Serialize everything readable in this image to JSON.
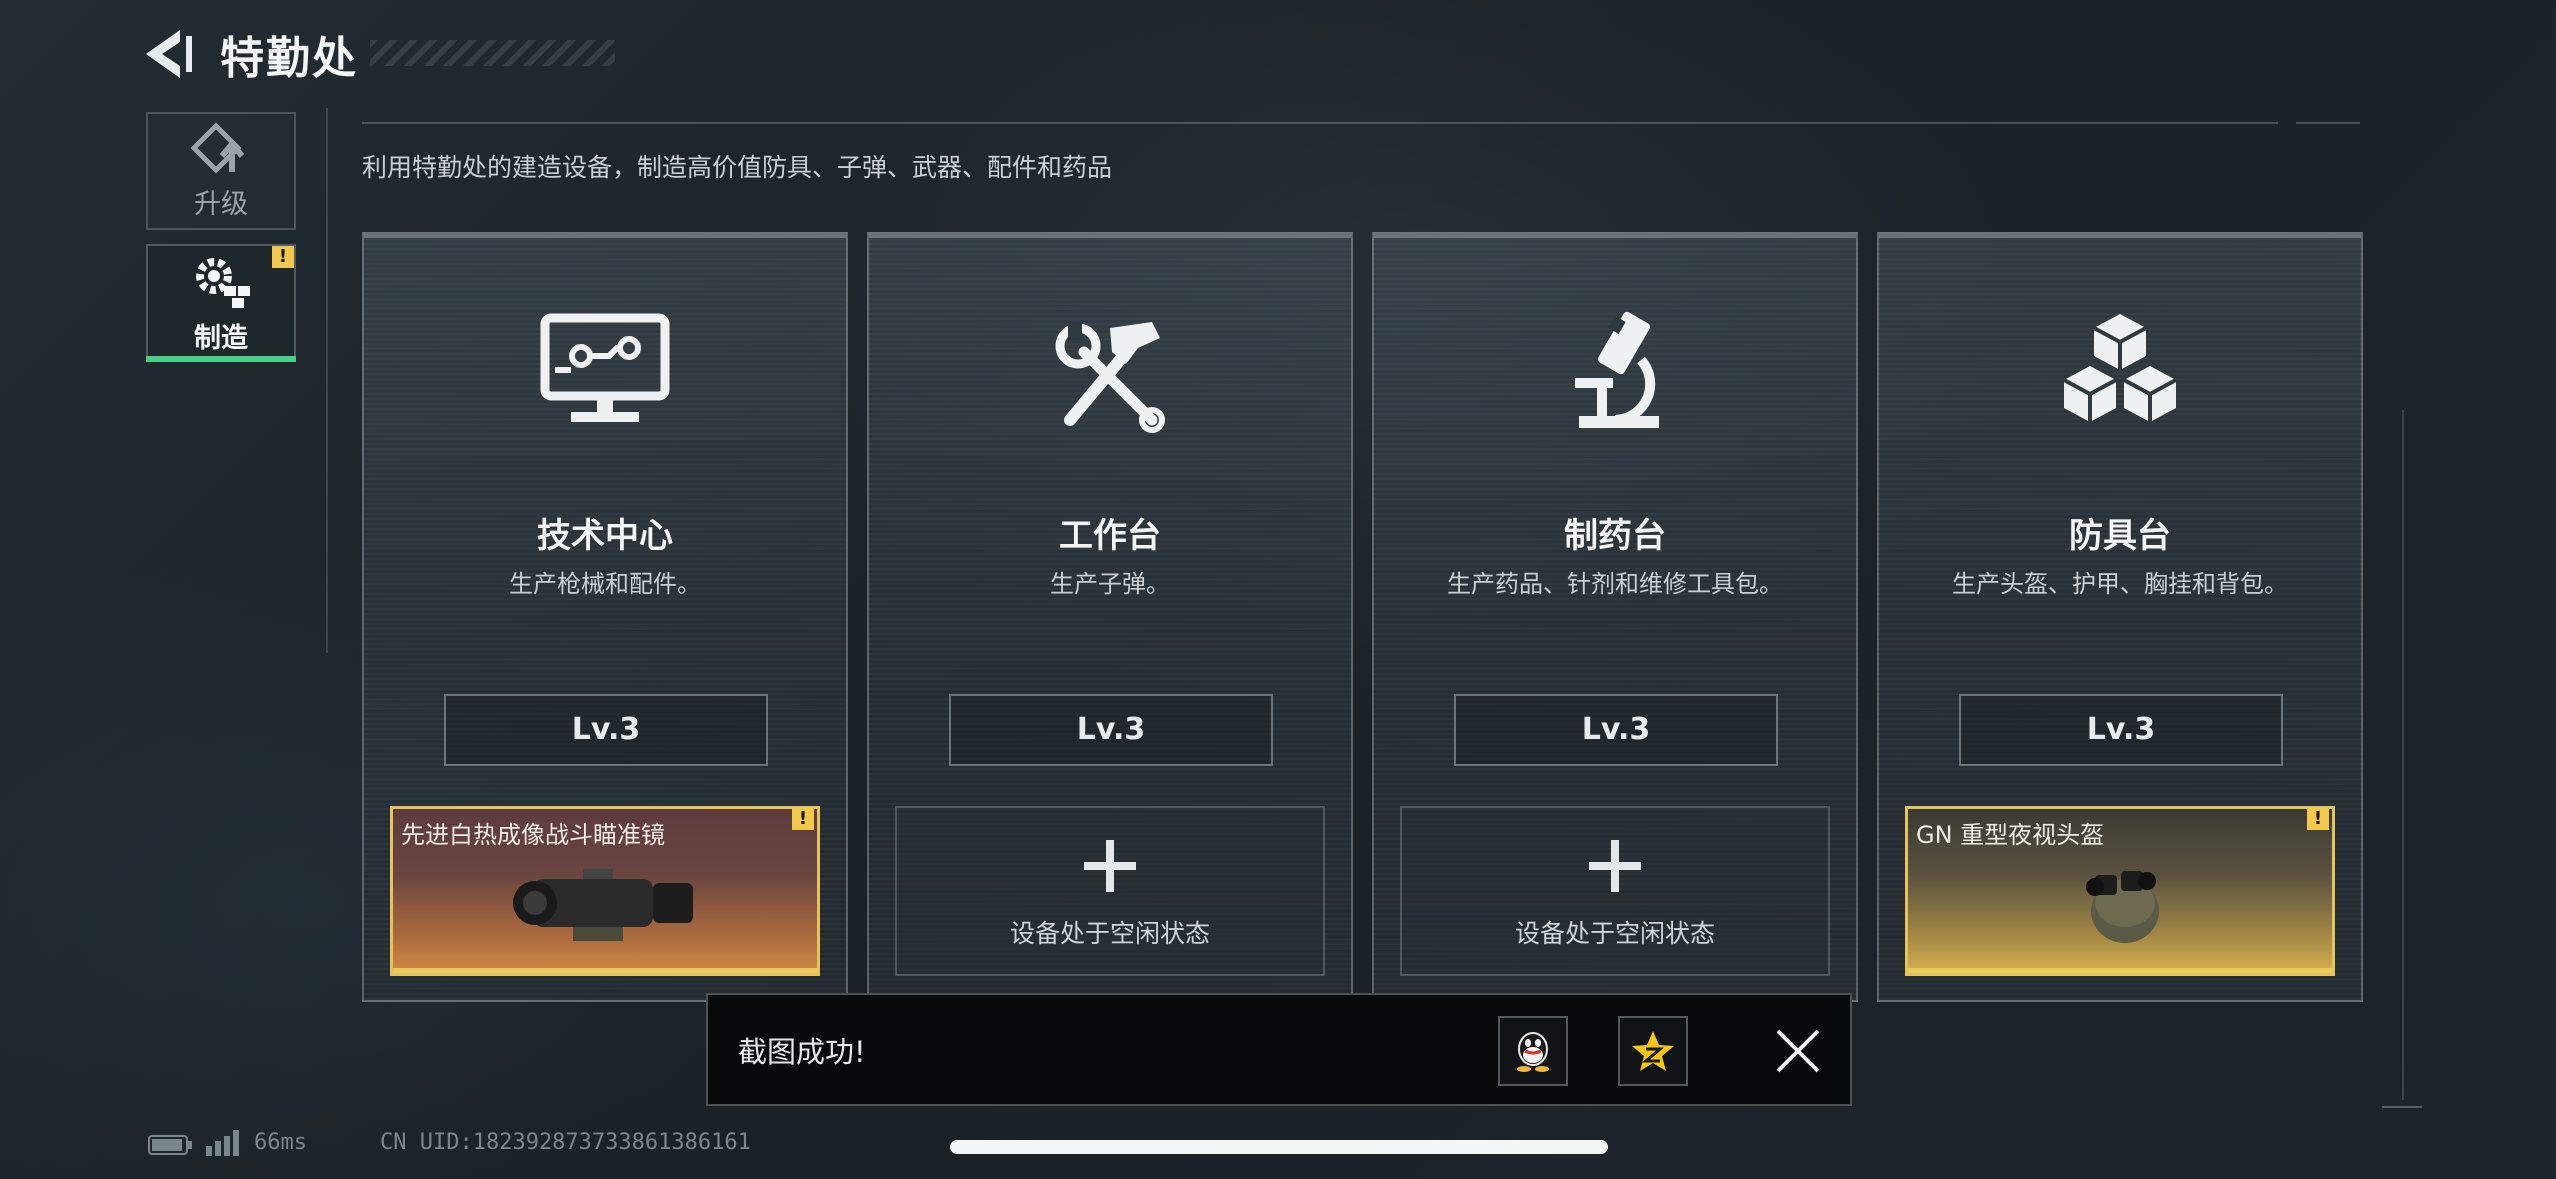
{
  "header": {
    "title": "特勤处",
    "back_icon": "back-arrow-icon"
  },
  "nav": {
    "items": [
      {
        "label": "升级",
        "icon": "upgrade-arrow-icon",
        "active": false,
        "alert": false
      },
      {
        "label": "制造",
        "icon": "gear-cubes-icon",
        "active": true,
        "alert": true,
        "alert_mark": "!"
      }
    ]
  },
  "subtitle": "利用特勤处的建造设备，制造高价值防具、子弹、武器、配件和药品",
  "stations": [
    {
      "name": "技术中心",
      "desc": "生产枪械和配件。",
      "level": "Lv.3",
      "icon": "monitor-icon",
      "slot": {
        "state": "busy",
        "text": "先进白热成像战斗瞄准镜",
        "alert_mark": "!",
        "item_icon": "thermal-scope-icon"
      }
    },
    {
      "name": "工作台",
      "desc": "生产子弹。",
      "level": "Lv.3",
      "icon": "hammer-wrench-icon",
      "slot": {
        "state": "idle",
        "text": "设备处于空闲状态",
        "item_icon": "plus-icon"
      }
    },
    {
      "name": "制药台",
      "desc": "生产药品、针剂和维修工具包。",
      "level": "Lv.3",
      "icon": "microscope-icon",
      "slot": {
        "state": "idle",
        "text": "设备处于空闲状态",
        "item_icon": "plus-icon"
      }
    },
    {
      "name": "防具台",
      "desc": "生产头盔、护甲、胸挂和背包。",
      "level": "Lv.3",
      "icon": "cubes-icon",
      "slot": {
        "state": "busy",
        "text": "GN 重型夜视头盔",
        "alert_mark": "!",
        "item_icon": "nvg-helmet-icon"
      }
    }
  ],
  "toast": {
    "text": "截图成功!",
    "share_icons": [
      "qq-icon",
      "qzone-icon"
    ],
    "close_icon": "close-icon"
  },
  "status_bar": {
    "ping": "66ms",
    "uid": "CN UID:1823928737338613861​61"
  },
  "colors": {
    "accent_green": "#4ccf8a",
    "alert_yellow": "#f2c94c",
    "slot_gold": "#e6c45a"
  }
}
